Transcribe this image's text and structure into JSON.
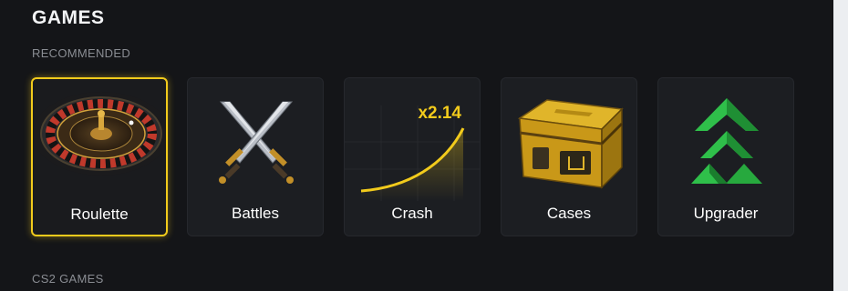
{
  "header": {
    "title": "GAMES"
  },
  "sections": {
    "recommended": "RECOMMENDED",
    "cs2": "CS2 GAMES"
  },
  "games": [
    {
      "label": "Roulette",
      "icon": "roulette-wheel-icon",
      "selected": true
    },
    {
      "label": "Battles",
      "icon": "crossed-swords-icon",
      "selected": false
    },
    {
      "label": "Crash",
      "icon": "crash-curve-icon",
      "multiplier": "x2.14",
      "selected": false
    },
    {
      "label": "Cases",
      "icon": "case-chest-icon",
      "selected": false
    },
    {
      "label": "Upgrader",
      "icon": "upgrade-arrows-icon",
      "selected": false
    }
  ],
  "colors": {
    "accent": "#f2cb1c",
    "card": "#1c1e22",
    "background": "#141518",
    "upgrade_green": "#2fbf4a"
  }
}
